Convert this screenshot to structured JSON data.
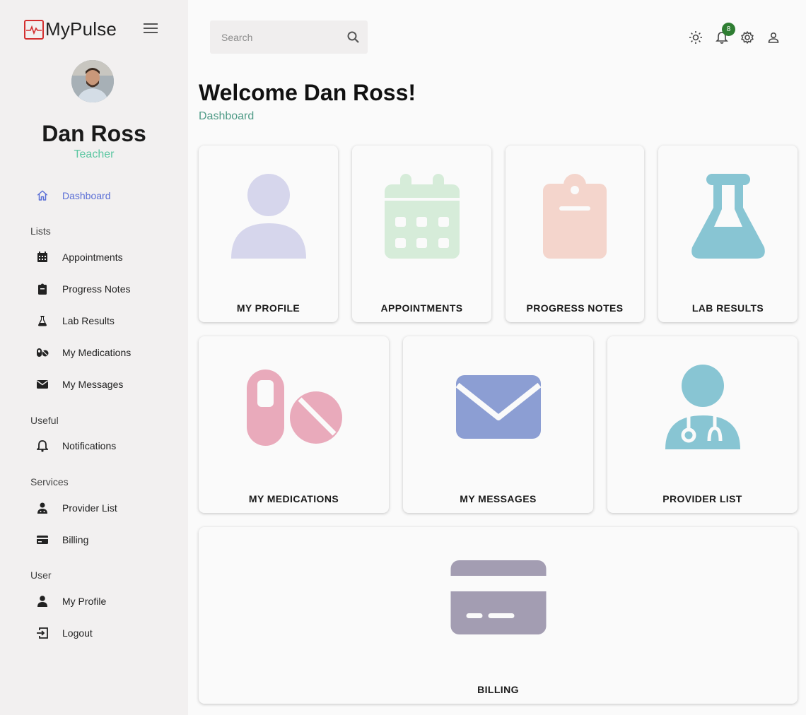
{
  "brand": {
    "name": "MyPulse"
  },
  "user": {
    "name": "Dan Ross",
    "role": "Teacher"
  },
  "nav": {
    "dashboard": "Dashboard",
    "sections": {
      "lists": "Lists",
      "useful": "Useful",
      "services": "Services",
      "user": "User"
    },
    "appointments": "Appointments",
    "progress_notes": "Progress Notes",
    "lab_results": "Lab Results",
    "my_medications": "My Medications",
    "my_messages": "My Messages",
    "notifications": "Notifications",
    "provider_list": "Provider List",
    "billing": "Billing",
    "my_profile": "My Profile",
    "logout": "Logout"
  },
  "search": {
    "placeholder": "Search"
  },
  "topbar": {
    "notification_count": "8"
  },
  "main": {
    "welcome": "Welcome Dan Ross!",
    "breadcrumb": "Dashboard"
  },
  "cards": {
    "my_profile": "MY PROFILE",
    "appointments": "APPOINTMENTS",
    "progress_notes": "PROGRESS NOTES",
    "lab_results": "LAB RESULTS",
    "my_medications": "MY MEDICATIONS",
    "my_messages": "MY MESSAGES",
    "provider_list": "PROVIDER LIST",
    "billing": "BILLING"
  },
  "colors": {
    "accent": "#5b6fd6",
    "role": "#5cc7a2",
    "breadcrumb": "#4f9b87",
    "badge": "#2e7d32",
    "profile_icon": "#d6d6ec",
    "calendar_icon": "#d6ecd9",
    "clipboard_icon": "#f4d5cc",
    "flask_icon": "#88c5d3",
    "pills_icon": "#e9aabb",
    "envelope_icon": "#8c9ed3",
    "doctor_icon": "#88c5d3",
    "card_icon": "#a39db2"
  }
}
